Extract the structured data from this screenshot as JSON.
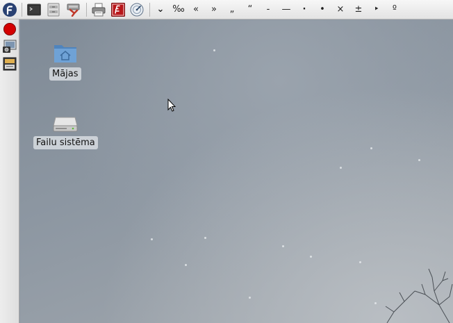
{
  "toolbar": {
    "launchers": [
      {
        "icon": "fedora-menu-icon"
      },
      {
        "icon": "terminal-icon"
      },
      {
        "icon": "file-manager-icon"
      },
      {
        "icon": "rescue-tool-icon"
      },
      {
        "icon": "printer-icon"
      },
      {
        "icon": "filezilla-icon"
      },
      {
        "icon": "browser-icon"
      }
    ],
    "chevron": "⌄",
    "characters": [
      "‰",
      "«",
      "»",
      "„",
      "“",
      "-",
      "—",
      "·",
      "•",
      "×",
      "±",
      "‣",
      "º"
    ]
  },
  "side_panel": {
    "items": [
      {
        "icon": "record-stop-icon"
      },
      {
        "icon": "screenshot-icon"
      },
      {
        "icon": "slideshow-icon"
      }
    ]
  },
  "desktop": {
    "icons": [
      {
        "label": "Mājas",
        "icon": "home-folder-icon"
      },
      {
        "label": "Failu sistēma",
        "icon": "hard-drive-icon"
      }
    ]
  },
  "colors": {
    "panel": "#e8e8e8",
    "record_red": "#d40000",
    "filezilla_red": "#b8171a",
    "folder_blue": "#5b8fc7"
  }
}
